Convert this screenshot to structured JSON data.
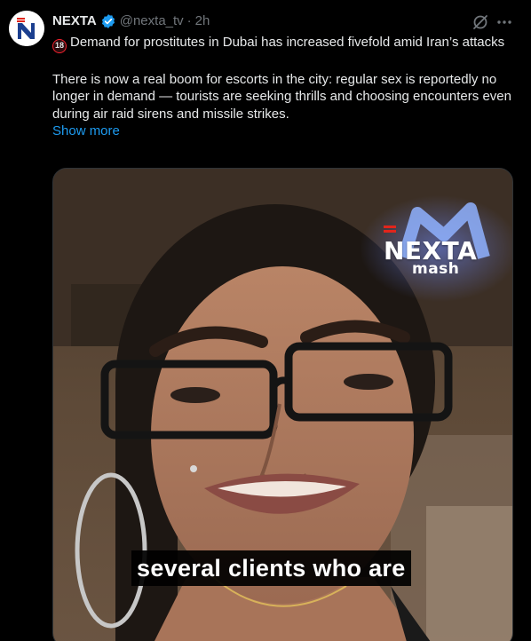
{
  "author": {
    "display_name": "NEXTA",
    "handle": "@nexta_tv",
    "separator": "·",
    "timestamp": "2h",
    "verified": true,
    "avatar_letter": "N"
  },
  "icons": {
    "verified": "verified-badge-icon",
    "grok": "grok-icon",
    "more": "more-options-icon",
    "age_rating": "18-plus-icon"
  },
  "tweet": {
    "age_badge": "18",
    "headline": "Demand for prostitutes in Dubai has increased fivefold amid Iran’s attacks",
    "body": "There is now a real boom for escorts in the city: regular sex is reportedly no longer in demand — tourists are seeking thrills and choosing encounters even during air raid sirens and missile strikes.",
    "show_more": "Show more"
  },
  "media": {
    "watermark_brand": "NEXTA",
    "watermark_sub": "mash",
    "caption": "several clients who are"
  },
  "colors": {
    "background": "#000000",
    "text": "#e7e9ea",
    "muted": "#71767b",
    "link": "#1d9bf0",
    "verified": "#1d9bf0",
    "brand_red": "#e1251b"
  }
}
